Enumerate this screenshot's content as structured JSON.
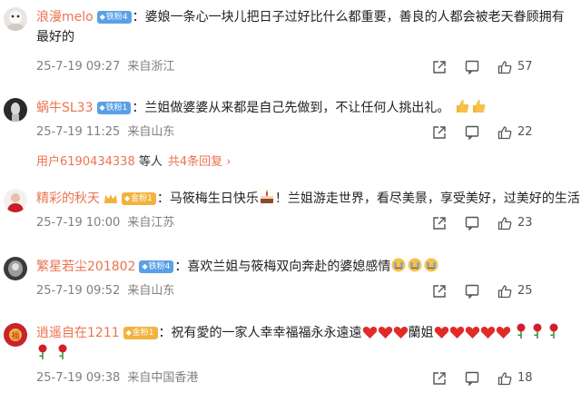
{
  "comments": [
    {
      "username": "浪漫melo",
      "badge": "铁粉4",
      "text": "：婆娘一条心一块儿把日子过好比什么都重要，善良的人都会被老天眷顾拥有最好的",
      "time": "25-7-19 09:27",
      "source": "来自浙江",
      "likes": "57"
    },
    {
      "username": "蜗牛SL33",
      "badge": "铁粉1",
      "text": "：兰姐做婆婆从来都是自己先做到，不让任何人挑出礼。",
      "time": "25-7-19 11:25",
      "source": "来自山东",
      "likes": "22"
    },
    {
      "username": "精彩的秋天",
      "badge": "金粉1",
      "text_a": "：马筱梅生日快乐",
      "text_b": "！兰姐游走世界，看尽美景，享受美好，过美好的生活！",
      "time": "25-7-19 10:00",
      "source": "来自江苏",
      "likes": "23"
    },
    {
      "username": "繁星若尘201802",
      "badge": "铁粉4",
      "text": "：喜欢兰姐与筱梅双向奔赴的婆媳感情",
      "time": "25-7-19 09:52",
      "source": "来自山东",
      "likes": "25"
    },
    {
      "username": "逍遥自在1211",
      "badge": "金粉1",
      "text_a": "：祝有愛的一家人幸幸福福永永遠遠",
      "text_b": "蘭姐",
      "time": "25-7-19 09:38",
      "source": "来自中国香港",
      "likes": "18"
    }
  ],
  "replies": {
    "user": "用户6190434338",
    "suffix": "等人",
    "link": "共4条回复",
    "arrow": "›"
  },
  "colors": {
    "username": "#eb7350",
    "meta": "#808080",
    "fans_badge": "#5aa0e6",
    "gold_badge": "#f2b33d"
  },
  "icons": [
    "share-icon",
    "comment-icon",
    "like-icon",
    "heart-emoji",
    "thumbs-up-emoji",
    "rose-emoji",
    "cake-emoji",
    "crying-face-emoji"
  ]
}
